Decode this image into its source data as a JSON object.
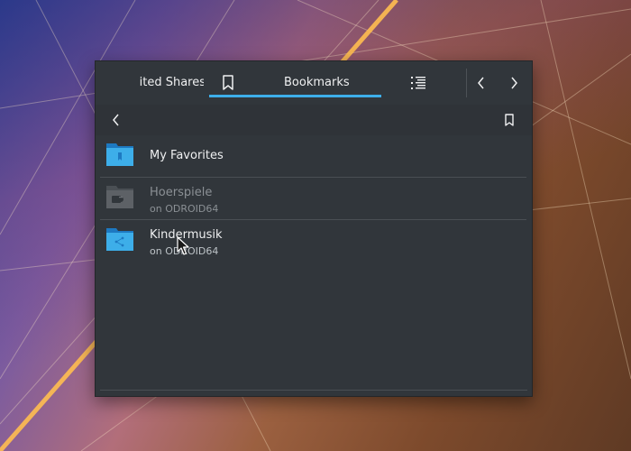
{
  "tabs": {
    "clipped_tab_label": "ited Shares",
    "bookmarks_label": "Bookmarks",
    "active_color": "#3daee9"
  },
  "toolbar": {
    "back_icon": "chevron-left-icon",
    "add_bookmark_icon": "bookmark-icon"
  },
  "bookmarks": [
    {
      "name": "My Favorites",
      "location": "",
      "icon": "folder-bookmark-icon",
      "state": "normal"
    },
    {
      "name": "Hoerspiele",
      "location": "on ODROID64",
      "icon": "folder-network-offline-icon",
      "state": "disabled"
    },
    {
      "name": "Kindermusik",
      "location": "on ODROID64",
      "icon": "folder-network-share-icon",
      "state": "normal"
    }
  ]
}
